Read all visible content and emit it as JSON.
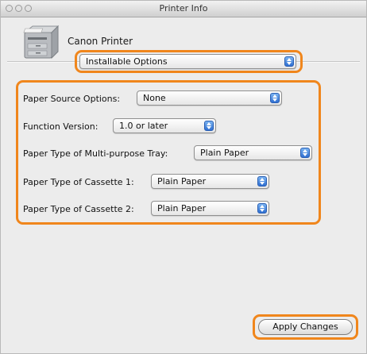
{
  "window": {
    "title": "Printer Info"
  },
  "printer": {
    "name": "Canon Printer",
    "icon": "printer-icon"
  },
  "view_selector": {
    "selected": "Installable Options"
  },
  "options": [
    {
      "label": "Paper Source Options:",
      "value": "None"
    },
    {
      "label": "Function Version:",
      "value": "1.0 or later"
    },
    {
      "label": "Paper Type of Multi-purpose Tray:",
      "value": "Plain Paper"
    },
    {
      "label": "Paper Type of Cassette 1:",
      "value": "Plain Paper"
    },
    {
      "label": "Paper Type of Cassette 2:",
      "value": "Plain Paper"
    }
  ],
  "apply_button": {
    "label": "Apply Changes"
  },
  "colors": {
    "highlight": "#f0861c",
    "popup_arrow": "#2f6fd1",
    "window_bg": "#ececec"
  }
}
